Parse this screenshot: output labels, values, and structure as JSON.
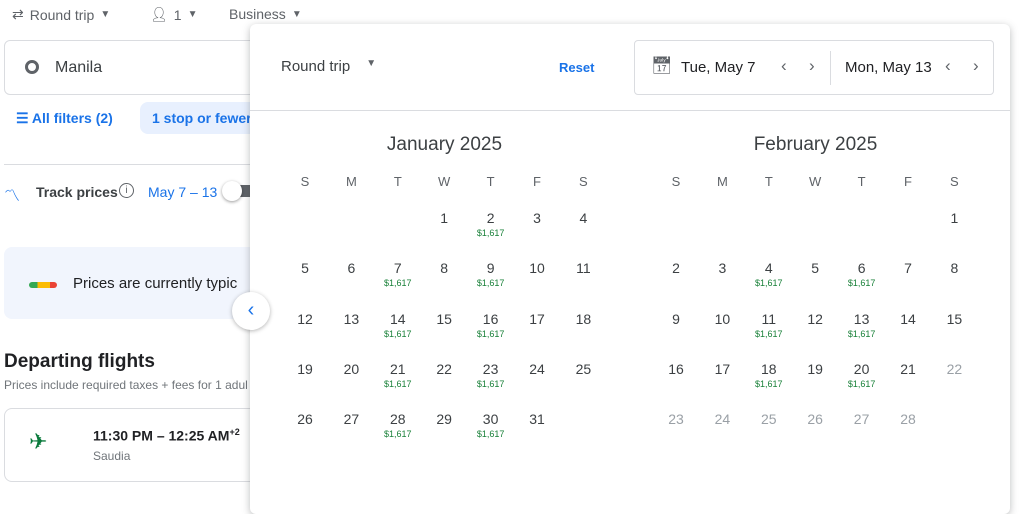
{
  "search": {
    "trip_type": "Round trip",
    "passengers": "1",
    "cabin": "Business",
    "origin": "Manila"
  },
  "filters": {
    "all_filters": "All filters (2)",
    "stops_chip": "1 stop or fewer"
  },
  "track": {
    "label": "Track prices",
    "dates": "May 7 – 13",
    "enabled": false
  },
  "banner": {
    "text": "Prices are currently typic"
  },
  "departing": {
    "title": "Departing flights",
    "subtitle": "Prices include required taxes + fees for 1 adul",
    "flights": [
      {
        "times": "11:30 PM – 12:25 AM",
        "day_offset": "+2",
        "airline": "Saudia"
      }
    ]
  },
  "picker": {
    "trip_type": "Round trip",
    "reset": "Reset",
    "depart": "Tue, May 7",
    "return": "Mon, May 13",
    "weekdays": [
      "S",
      "M",
      "T",
      "W",
      "T",
      "F",
      "S"
    ],
    "months": [
      {
        "title": "January 2025",
        "weeks": [
          [
            null,
            null,
            null,
            1,
            2,
            3,
            4
          ],
          [
            5,
            6,
            7,
            8,
            9,
            10,
            11
          ],
          [
            12,
            13,
            14,
            15,
            16,
            17,
            18
          ],
          [
            19,
            20,
            21,
            22,
            23,
            24,
            25
          ],
          [
            26,
            27,
            28,
            29,
            30,
            31,
            null
          ]
        ],
        "prices": {
          "2": "$1,617",
          "7": "$1,617",
          "9": "$1,617",
          "14": "$1,617",
          "16": "$1,617",
          "21": "$1,617",
          "23": "$1,617",
          "28": "$1,617",
          "30": "$1,617"
        },
        "disabled": []
      },
      {
        "title": "February 2025",
        "weeks": [
          [
            null,
            null,
            null,
            null,
            null,
            null,
            1
          ],
          [
            2,
            3,
            4,
            5,
            6,
            7,
            8
          ],
          [
            9,
            10,
            11,
            12,
            13,
            14,
            15
          ],
          [
            16,
            17,
            18,
            19,
            20,
            21,
            22
          ],
          [
            23,
            24,
            25,
            26,
            27,
            28,
            null
          ]
        ],
        "prices": {
          "4": "$1,617",
          "6": "$1,617",
          "11": "$1,617",
          "13": "$1,617",
          "18": "$1,617",
          "20": "$1,617"
        },
        "disabled": [
          22,
          23,
          24,
          25,
          26,
          27,
          28
        ]
      }
    ]
  },
  "colors": {
    "accent": "#1a73e8",
    "price": "#188038"
  }
}
